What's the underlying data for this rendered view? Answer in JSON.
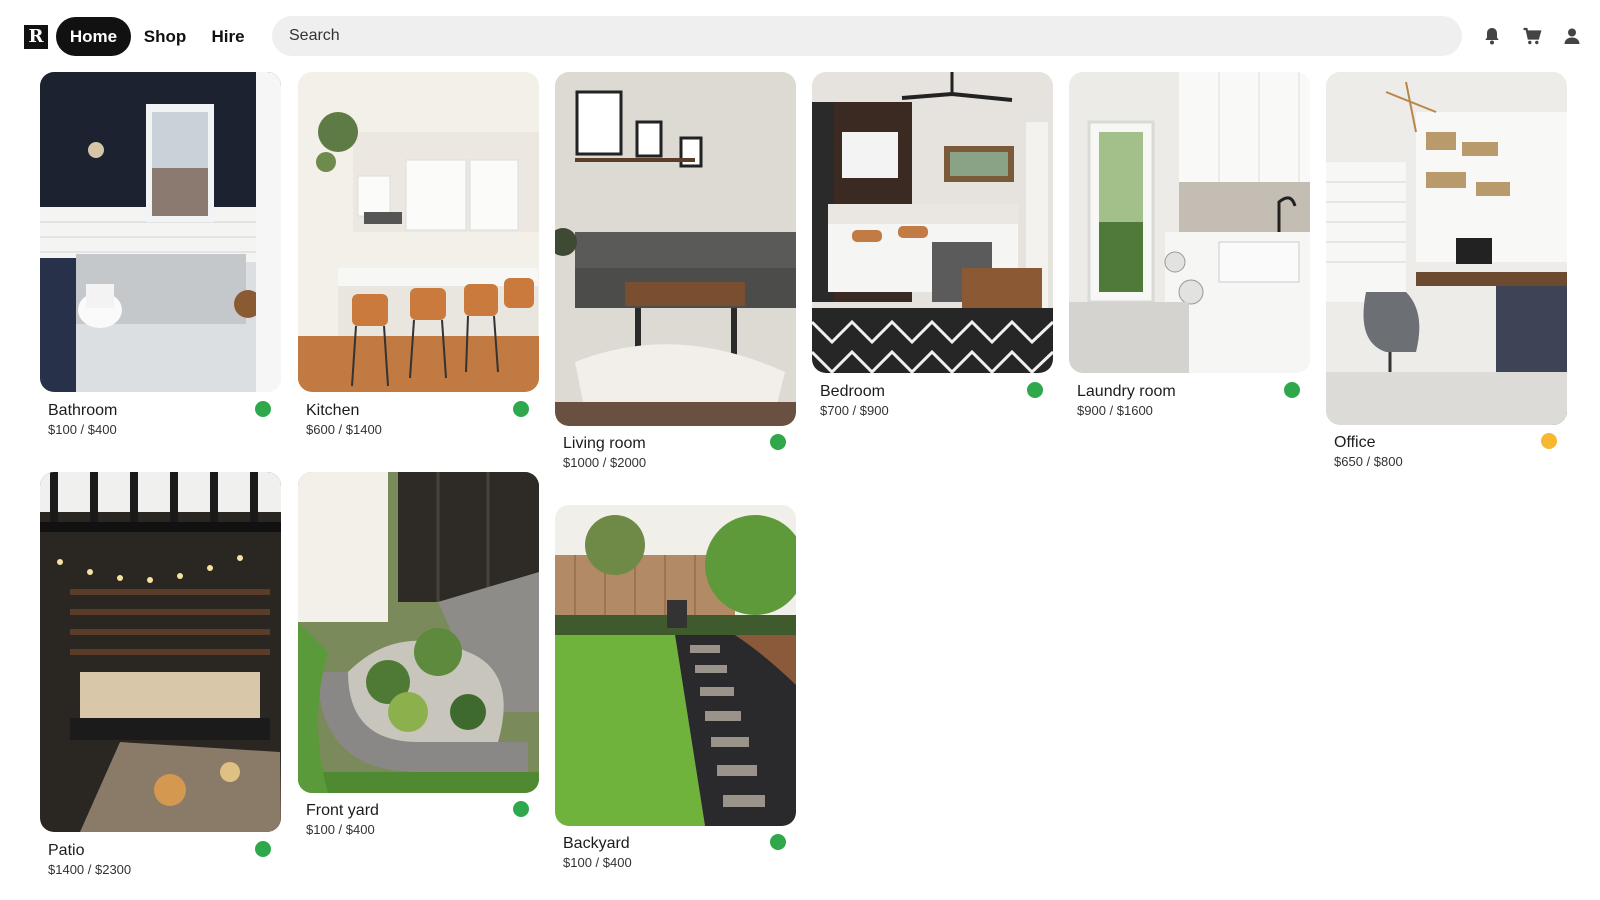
{
  "header": {
    "logo_letter": "R",
    "nav": [
      {
        "label": "Home",
        "active": true
      },
      {
        "label": "Shop",
        "active": false
      },
      {
        "label": "Hire",
        "active": false
      }
    ],
    "search": {
      "placeholder": "Search",
      "value": ""
    },
    "icons": [
      "bell-icon",
      "cart-icon",
      "user-icon"
    ]
  },
  "status_colors": {
    "green": "#2ea84a",
    "yellow": "#f5b82e"
  },
  "cards": [
    {
      "title": "Bathroom",
      "price": "$100 / $400",
      "status": "green"
    },
    {
      "title": "Kitchen",
      "price": "$600 / $1400",
      "status": "green"
    },
    {
      "title": "Living room",
      "price": "$1000 / $2000",
      "status": "green"
    },
    {
      "title": "Bedroom",
      "price": "$700 / $900",
      "status": "green"
    },
    {
      "title": "Laundry room",
      "price": "$900 / $1600",
      "status": "green"
    },
    {
      "title": "Office",
      "price": "$650 / $800",
      "status": "yellow"
    },
    {
      "title": "Patio",
      "price": "$1400 / $2300",
      "status": "green"
    },
    {
      "title": "Front yard",
      "price": "$100 / $400",
      "status": "green"
    },
    {
      "title": "Backyard",
      "price": "$100 / $400",
      "status": "green"
    }
  ]
}
